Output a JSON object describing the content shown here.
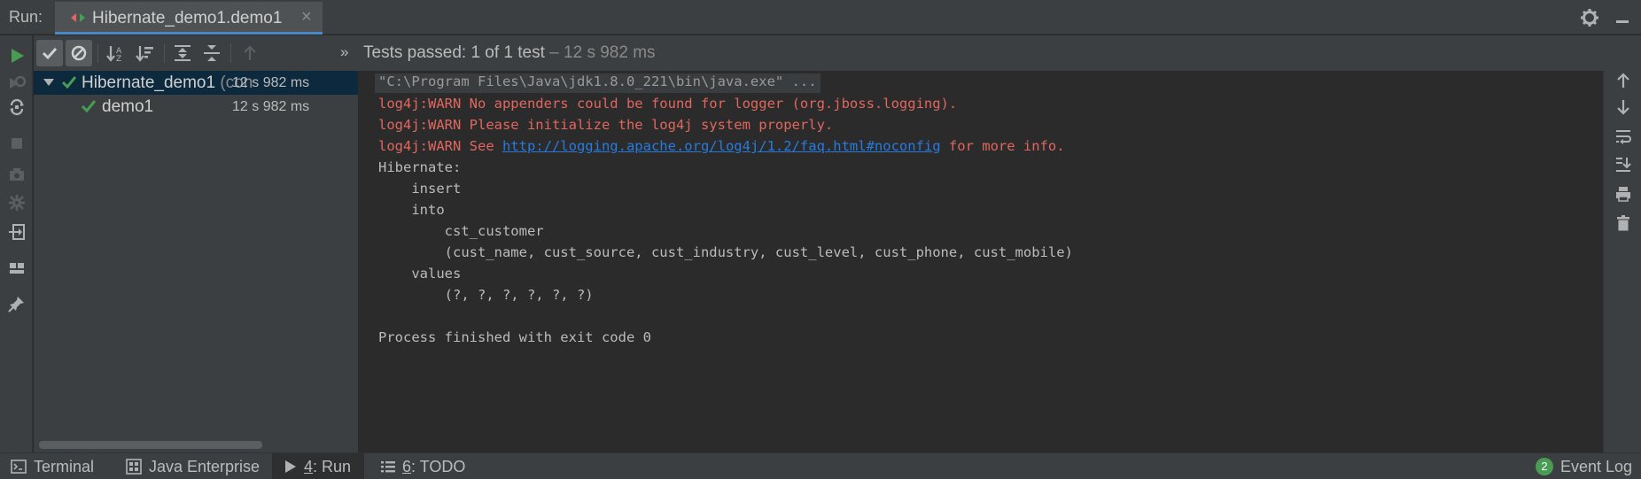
{
  "topbar": {
    "run_label": "Run:",
    "tab_title": "Hibernate_demo1.demo1",
    "tab_close": "×"
  },
  "testbar": {
    "chevrons": "»",
    "status_prefix": "Tests passed: ",
    "status_count": "1",
    "status_mid": " of 1 test",
    "status_time": " – 12 s 982 ms"
  },
  "tree": {
    "rows": [
      {
        "name": "Hibernate_demo1",
        "name_suffix": " (con",
        "time": "12 s 982 ms"
      },
      {
        "name": "demo1",
        "name_suffix": "",
        "time": "12 s 982 ms"
      }
    ]
  },
  "console": {
    "cmd": "\"C:\\Program Files\\Java\\jdk1.8.0_221\\bin\\java.exe\" ...",
    "warn1": "log4j:WARN No appenders could be found for logger (org.jboss.logging).",
    "warn2": "log4j:WARN Please initialize the log4j system properly.",
    "warn3_pre": "log4j:WARN See ",
    "warn3_link": "http://logging.apache.org/log4j/1.2/faq.html#noconfig",
    "warn3_post": " for more info.",
    "lines": [
      "Hibernate: ",
      "    insert ",
      "    into",
      "        cst_customer",
      "        (cust_name, cust_source, cust_industry, cust_level, cust_phone, cust_mobile) ",
      "    values",
      "        (?, ?, ?, ?, ?, ?)",
      "",
      "Process finished with exit code 0"
    ]
  },
  "bottombar": {
    "terminal": "Terminal",
    "java_enterprise": "Java Enterprise",
    "run_num": "4",
    "run_label": ": Run",
    "todo_num": "6",
    "todo_label": ": TODO",
    "event_count": "2",
    "event_log": "Event Log"
  },
  "colors": {
    "background": "#2b2b2b",
    "panel": "#3c3f41",
    "warn": "#e0675f",
    "link": "#287bde",
    "pass": "#499c54",
    "selection": "#0d293e"
  }
}
